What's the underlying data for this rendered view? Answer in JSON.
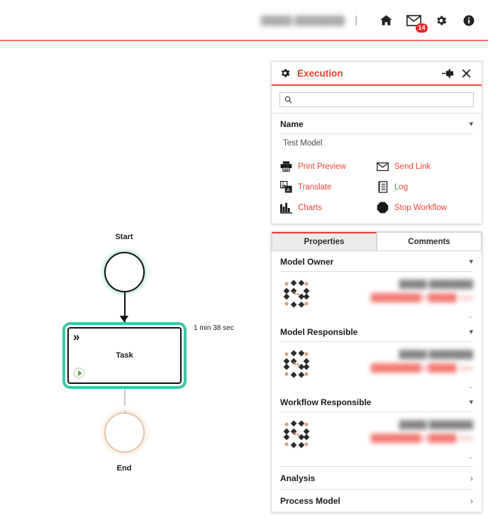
{
  "topbar": {
    "user_name": "█████ ████████",
    "separator": "|",
    "home_icon": "home-icon",
    "mail_icon": "mail-icon",
    "mail_badge": "14",
    "settings_icon": "gear-icon",
    "info_icon": "info-icon",
    "accent_rule_color": "#f0736a"
  },
  "diagram": {
    "start_label": "Start",
    "task_label": "Task",
    "end_label": "End",
    "duration_label": "1 min 38 sec",
    "task_marker": "»",
    "selection_color": "#3fc7a8",
    "start_glow_color": "#2ebe96",
    "end_color": "#e2c6ad",
    "play_color": "#63ac3c"
  },
  "execution_panel": {
    "title": "Execution",
    "title_color": "#ea3d32",
    "gear_icon": "gear-icon",
    "pin_icon": "pin-icon",
    "close_icon": "close-icon",
    "search": {
      "value": "",
      "placeholder": "",
      "icon": "search-icon"
    },
    "name_section": {
      "title": "Name",
      "chevron": "chevron-down-icon",
      "value": "Test Model"
    },
    "actions": [
      {
        "label": "Print Preview",
        "icon": "printer-icon"
      },
      {
        "label": "Send Link",
        "icon": "envelope-icon"
      },
      {
        "label": "Translate",
        "icon": "translate-icon"
      },
      {
        "label": "Log",
        "icon": "list-document-icon"
      },
      {
        "label": "Charts",
        "icon": "bar-chart-icon"
      },
      {
        "label": "Stop Workflow",
        "icon": "stop-octagon-icon"
      }
    ]
  },
  "properties_panel": {
    "tabs": [
      {
        "label": "Properties",
        "active": true
      },
      {
        "label": "Comments",
        "active": false
      }
    ],
    "sections": [
      {
        "title": "Model Owner",
        "chevron": "chevron-down-icon",
        "person": {
          "avatar": "identicon-avatar",
          "name": "█████ ████████",
          "email": "█████████@█████.com",
          "trailing": "-"
        }
      },
      {
        "title": "Model Responsible",
        "chevron": "chevron-down-icon",
        "person": {
          "avatar": "identicon-avatar",
          "name": "█████ ████████",
          "email": "█████████@█████.com",
          "trailing": "-"
        }
      },
      {
        "title": "Workflow Responsible",
        "chevron": "chevron-down-icon",
        "person": {
          "avatar": "identicon-avatar",
          "name": "█████ ████████",
          "email": "█████████@█████.com",
          "trailing": "-"
        }
      }
    ],
    "collapsed_rows": [
      {
        "title": "Analysis",
        "caret": "chevron-right-icon"
      },
      {
        "title": "Process Model",
        "caret": "chevron-right-icon"
      }
    ]
  }
}
